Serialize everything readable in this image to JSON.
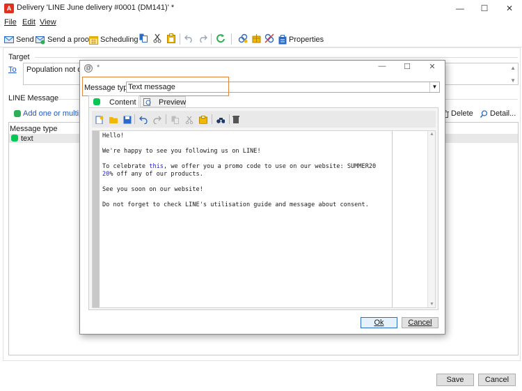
{
  "window": {
    "title": "Delivery 'LINE June delivery #0001 (DM141)' *",
    "app_icon": "A",
    "controls": {
      "minimize": "—",
      "maximize": "☐",
      "close": "✕"
    }
  },
  "menu": {
    "file": "File",
    "edit": "Edit",
    "view": "View"
  },
  "toolbar": {
    "send": "Send",
    "send_proof": "Send a proof",
    "scheduling": "Scheduling",
    "properties": "Properties"
  },
  "target": {
    "section_label": "Target",
    "to_link": "To",
    "population_text": "Population not def"
  },
  "line_message": {
    "section_label": "LINE Message",
    "add_button": "Add one or multipl",
    "delete_button": "Delete",
    "detail_button": "Detail...",
    "column_header": "Message type",
    "rows": [
      {
        "type": "text"
      }
    ]
  },
  "footer": {
    "save": "Save",
    "cancel": "Cancel"
  },
  "dialog": {
    "title_icon": "@",
    "title": "*",
    "message_type_label": "Message type",
    "message_type_value": "Text message",
    "tabs": {
      "content": "Content",
      "preview": "Preview"
    },
    "editor_lines": [
      {
        "text": "Hello!"
      },
      {
        "text": ""
      },
      {
        "text": "We're happy to see you following us on LINE!"
      },
      {
        "text": ""
      },
      {
        "pre": "To celebrate ",
        "blue": "this",
        "post": ", we offer you a promo code to use on our website: SUMMER20"
      },
      {
        "blue": "20",
        "post": "% off any of our products."
      },
      {
        "text": ""
      },
      {
        "text": "See you soon on our website!"
      },
      {
        "text": ""
      },
      {
        "text": "Do not forget to check LINE's utilisation guide and message about consent."
      }
    ],
    "ok": "Ok",
    "cancel": "Cancel"
  },
  "colors": {
    "accent_orange": "#e8833a",
    "link_blue": "#1a56c9",
    "line_green": "#06c755",
    "title_red": "#e0301e"
  }
}
